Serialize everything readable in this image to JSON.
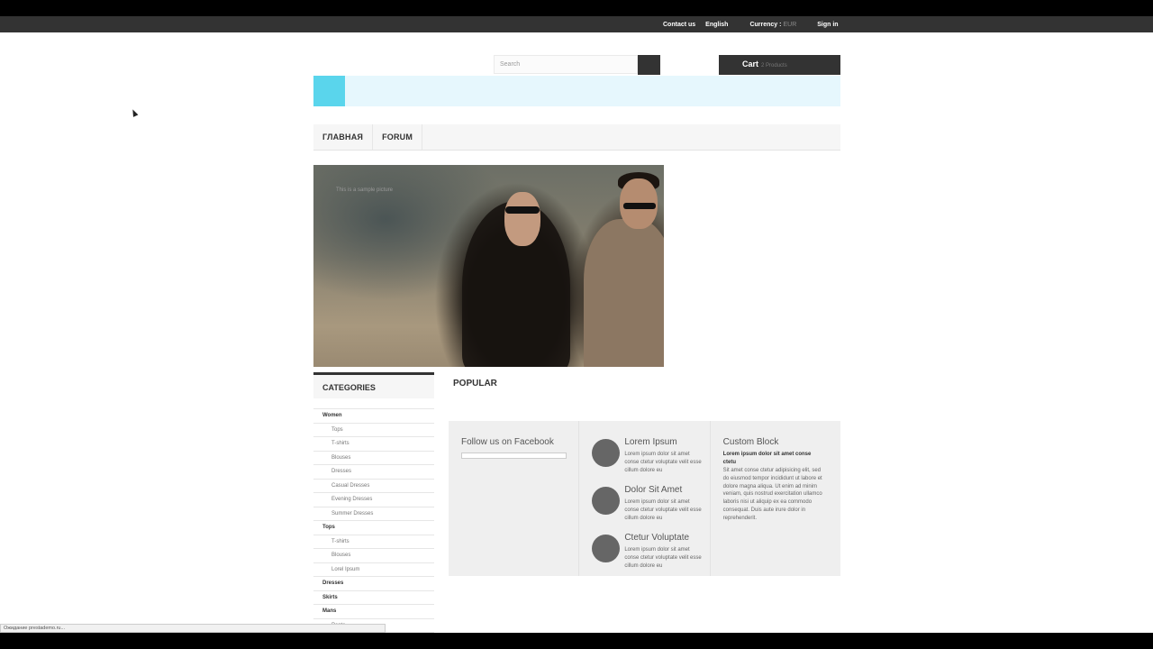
{
  "topnav": {
    "contact_us": "Contact us",
    "language": "English",
    "currency_label": "Currency :",
    "currency_value": "EUR",
    "sign_in": "Sign in"
  },
  "header": {
    "search_placeholder": "Search",
    "cart_label": "Cart",
    "cart_count": "2 Products"
  },
  "menu": {
    "items": [
      "ГЛАВНАЯ",
      "FORUM"
    ]
  },
  "hero": {
    "caption": "This is a sample picture"
  },
  "categories": {
    "title": "CATEGORIES",
    "items": [
      {
        "label": "Women",
        "level": "top"
      },
      {
        "label": "Tops",
        "level": "sub"
      },
      {
        "label": "T-shirts",
        "level": "sub"
      },
      {
        "label": "Blouses",
        "level": "sub"
      },
      {
        "label": "Dresses",
        "level": "sub"
      },
      {
        "label": "Casual Dresses",
        "level": "sub"
      },
      {
        "label": "Evening Dresses",
        "level": "sub"
      },
      {
        "label": "Summer Dresses",
        "level": "sub"
      },
      {
        "label": "Tops",
        "level": "top"
      },
      {
        "label": "T-shirts",
        "level": "sub"
      },
      {
        "label": "Blouses",
        "level": "sub"
      },
      {
        "label": "Lorel Ipsum",
        "level": "sub"
      },
      {
        "label": "Dresses",
        "level": "top"
      },
      {
        "label": "Skirts",
        "level": "top"
      },
      {
        "label": "Mans",
        "level": "top"
      },
      {
        "label": "Pants",
        "level": "sub"
      }
    ]
  },
  "popular": {
    "title": "POPULAR"
  },
  "footer": {
    "facebook_title": "Follow us on Facebook",
    "features": [
      {
        "title": "Lorem Ipsum",
        "text": "Lorem ipsum dolor sit amet conse ctetur voluptate velit esse cillum dolore eu"
      },
      {
        "title": "Dolor Sit Amet",
        "text": "Lorem ipsum dolor sit amet conse ctetur voluptate velit esse cillum dolore eu"
      },
      {
        "title": "Ctetur Voluptate",
        "text": "Lorem ipsum dolor sit amet conse ctetur voluptate velit esse cillum dolore eu"
      }
    ],
    "custom_block": {
      "title": "Custom Block",
      "subtitle": "Lorem ipsum dolor sit amet conse ctetu",
      "text": "Sit amet conse ctetur adipisicing elit, sed do eiusmod tempor incididunt ut labore et dolore magna aliqua. Ut enim ad minim veniam, quis nostrud exercitation ullamco laboris nisi ut aliquip ex ea commodo consequat. Duis aute irure dolor in reprehenderit."
    }
  },
  "statusbar": {
    "text": "Ожидание prestademo.ru..."
  },
  "colors": {
    "accent": "#5ad5ec",
    "banner_bg": "#e6f7fd",
    "dark": "#333333"
  }
}
